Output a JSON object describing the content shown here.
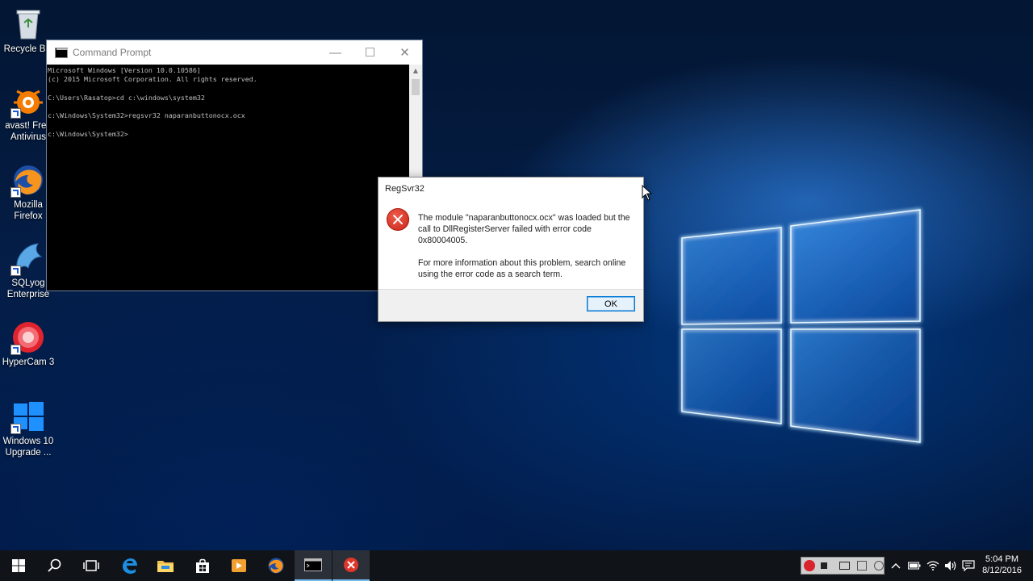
{
  "desktop": {
    "icons": [
      {
        "label": "Recycle Bin"
      },
      {
        "label": "avast! Free Antivirus"
      },
      {
        "label": "Mozilla Firefox"
      },
      {
        "label": "SQLyog Enterprise"
      },
      {
        "label": "HyperCam 3"
      },
      {
        "label": "Windows 10 Upgrade ..."
      }
    ]
  },
  "cmd_window": {
    "title": "Command Prompt",
    "lines": [
      "Microsoft Windows [Version 10.0.10586]",
      "(c) 2015 Microsoft Corporation. All rights reserved.",
      "",
      "C:\\Users\\Rasatop>cd c:\\windows\\system32",
      "",
      "c:\\Windows\\System32>regsvr32 naparanbuttonocx.ocx",
      "",
      "c:\\Windows\\System32>"
    ]
  },
  "dialog": {
    "title": "RegSvr32",
    "message1": "The module \"naparanbuttonocx.ocx\" was loaded but the call to DllRegisterServer failed with error code 0x80004005.",
    "message2": "For more information about this problem, search online using the error code as a search term.",
    "ok_label": "OK"
  },
  "taskbar": {
    "time": "5:04 PM",
    "date": "8/12/2016",
    "accent": "#76b9ed"
  }
}
